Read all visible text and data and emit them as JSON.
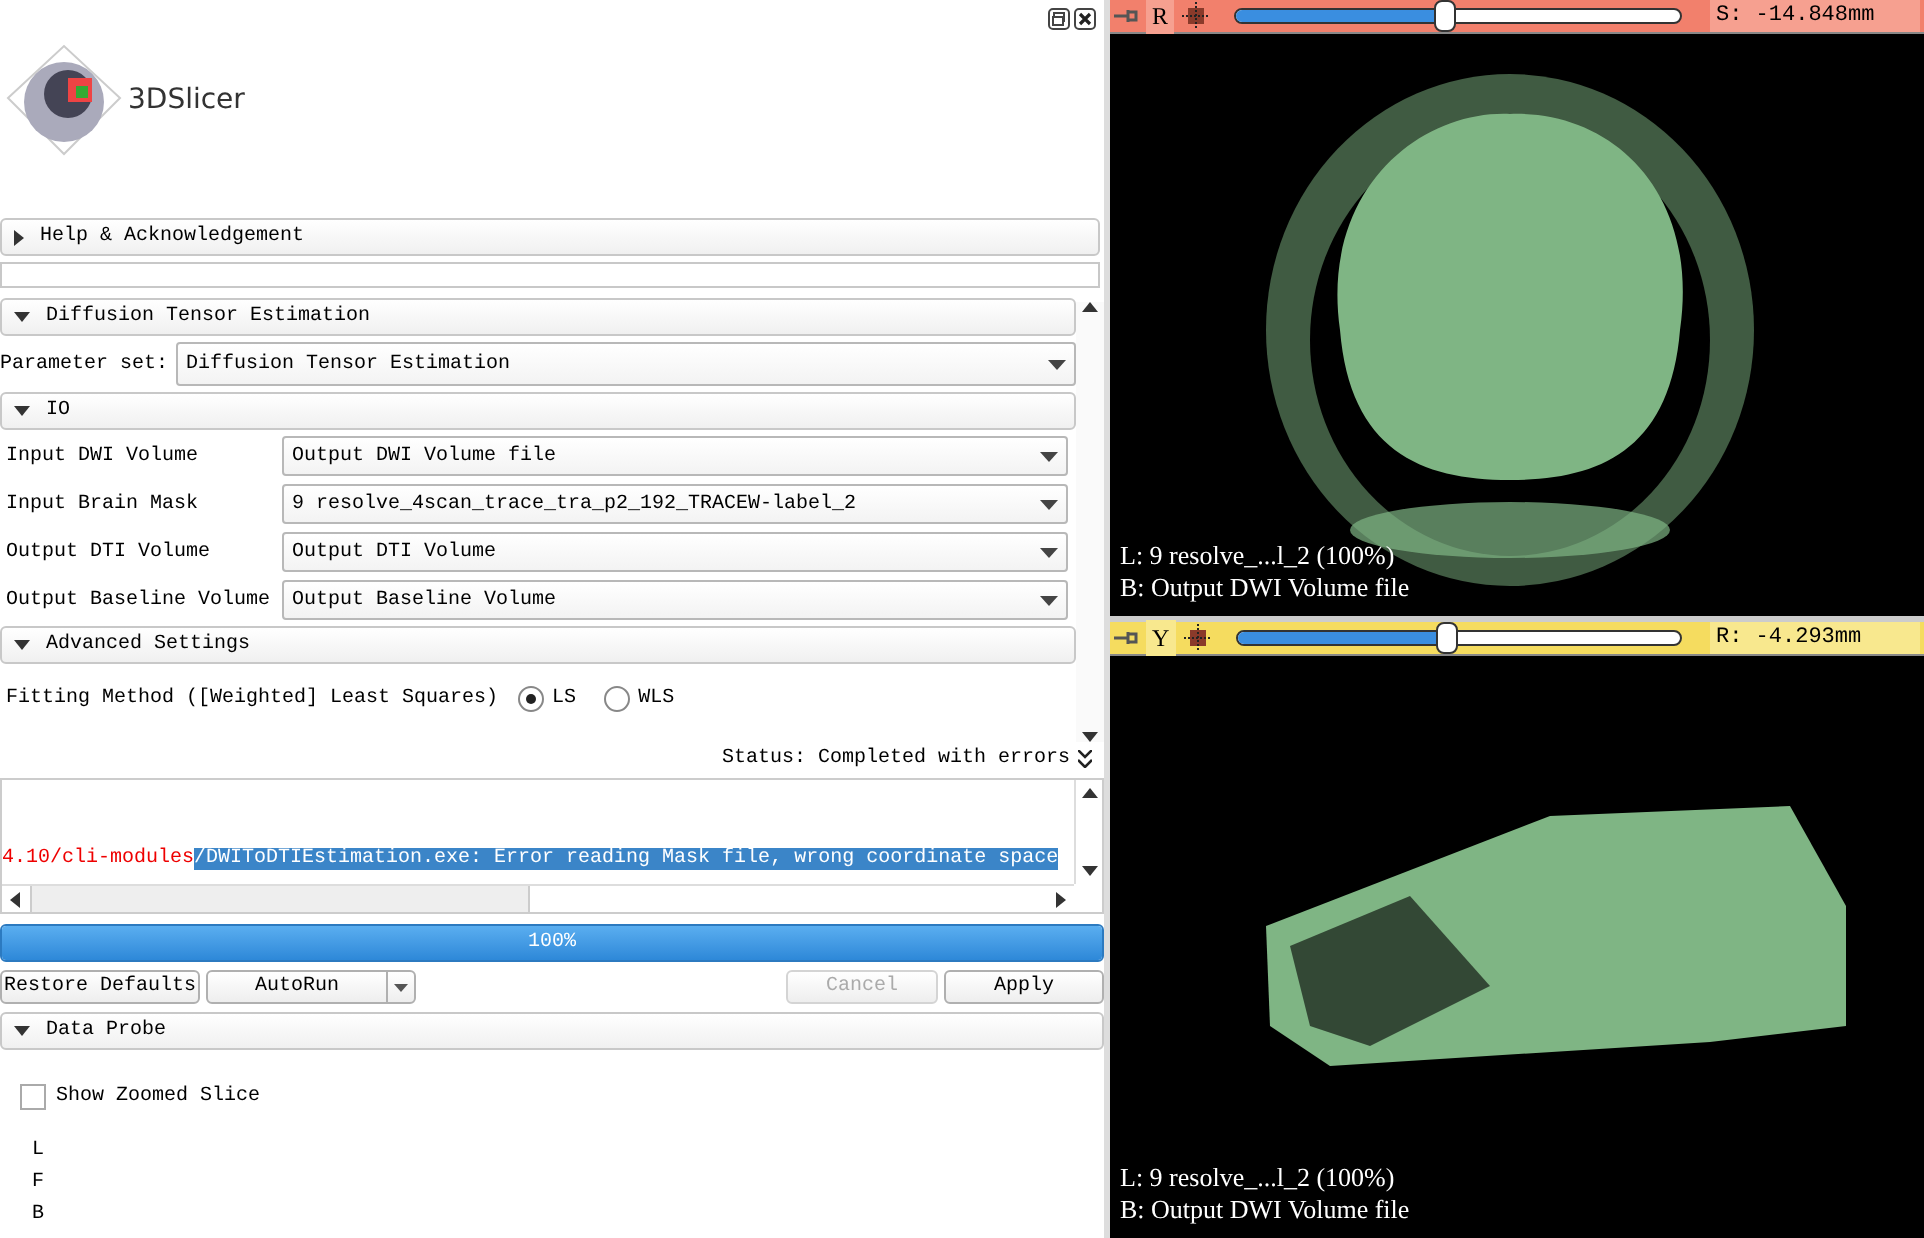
{
  "logo": {
    "text": "3DSlicer"
  },
  "help_section": {
    "title": "Help & Acknowledgement",
    "expanded": false
  },
  "module_section": {
    "title": "Diffusion Tensor Estimation",
    "expanded": true
  },
  "parameter_set": {
    "label": "Parameter set:",
    "value": "Diffusion Tensor Estimation"
  },
  "io_section": {
    "title": "IO",
    "expanded": true
  },
  "io_fields": [
    {
      "label": "Input DWI Volume",
      "value": "Output DWI Volume file"
    },
    {
      "label": "Input Brain Mask",
      "value": "9 resolve_4scan_trace_tra_p2_192_TRACEW-label_2"
    },
    {
      "label": "Output DTI Volume",
      "value": "Output DTI Volume"
    },
    {
      "label": "Output Baseline Volume",
      "value": "Output Baseline Volume"
    }
  ],
  "advanced_section": {
    "title": "Advanced Settings",
    "expanded": true
  },
  "fitting_method": {
    "label": "Fitting Method ([Weighted] Least Squares)",
    "options": [
      {
        "label": "LS",
        "selected": true
      },
      {
        "label": "WLS",
        "selected": false
      }
    ]
  },
  "status": {
    "text": "Status: Completed with errors"
  },
  "log": {
    "path_text": "4.10/cli-modules",
    "selected_text": "/DWIToDTIEstimation.exe: Error reading Mask file, wrong coordinate space"
  },
  "progress": {
    "level": 1,
    "text": "100%"
  },
  "buttons": [
    {
      "label": "Restore Defaults",
      "kind": "plain",
      "disabled": false
    },
    {
      "label": "AutoRun",
      "kind": "split",
      "disabled": false
    },
    {
      "label": "Cancel",
      "kind": "plain",
      "disabled": true
    },
    {
      "label": "Apply",
      "kind": "plain",
      "disabled": false
    }
  ],
  "data_probe": {
    "title": "Data Probe",
    "expanded": true,
    "show_zoomed_slice": {
      "label": "Show Zoomed Slice",
      "checked": false
    },
    "lines": [
      "L",
      "F",
      "B"
    ]
  },
  "viewers": [
    {
      "kind": "axial",
      "color": "#f2806c",
      "orientation": "R",
      "level": 0.47,
      "reading": "S: -14.848mm",
      "overlay": [
        "L: 9 resolve_...l_2 (100%)",
        "B: Output DWI Volume file"
      ]
    },
    {
      "kind": "sagittal",
      "color": "#f5dc5f",
      "orientation": "Y",
      "level": 0.47,
      "reading": "R: -4.293mm",
      "overlay": [
        "L: 9 resolve_...l_2 (100%)",
        "B: Output DWI Volume file"
      ]
    }
  ]
}
